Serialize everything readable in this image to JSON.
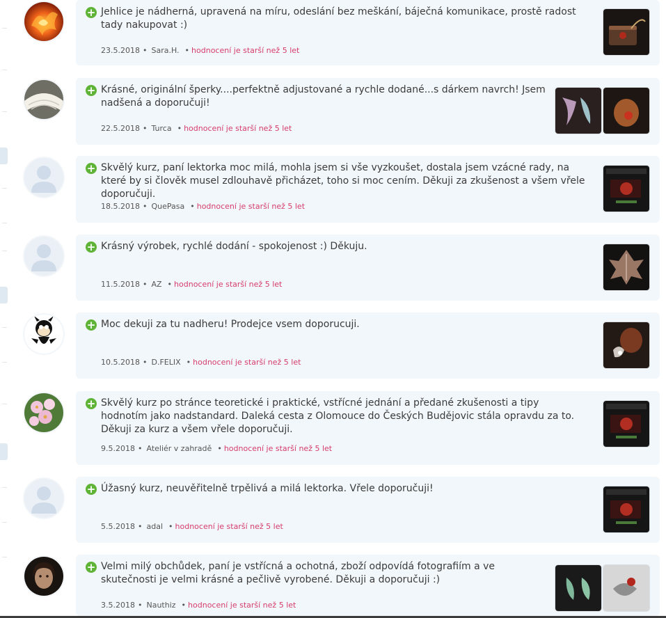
{
  "old_label": "hodnocení je starší než 5 let",
  "reviews": [
    {
      "text": "Jehlice je nádherná, upravená na míru, odeslání bez meškání, báječná komunikace, prostě radost tady nakupovat :)",
      "date": "23.5.2018",
      "author": "Sara.H.",
      "photos": 1,
      "avatar_type": "phoenix-image"
    },
    {
      "text": "Krásné, originální šperky....perfektně adjustované a rychle dodané...s dárkem navrch! Jsem nadšená a doporučuji!",
      "date": "22.5.2018",
      "author": "Turca",
      "photos": 2,
      "avatar_type": "lace-image"
    },
    {
      "text": "Skvělý kurz, paní lektorka moc milá, mohla jsem si vše vyzkoušet, dostala jsem vzácné rady, na které by si člověk musel zdlouhavě přicházet, toho si moc cením. Děkuji za zkušenost a všem vřele doporučuji.",
      "date": "18.5.2018",
      "author": "QuePasa",
      "photos": 1,
      "avatar_type": "default-user"
    },
    {
      "text": "Krásný výrobek, rychlé dodání - spokojenost :) Děkuju.",
      "date": "11.5.2018",
      "author": "AZ",
      "photos": 1,
      "avatar_type": "default-user"
    },
    {
      "text": "Moc dekuji za tu nadheru! Prodejce vsem doporucuji.",
      "date": "10.5.2018",
      "author": "D.FELIX",
      "photos": 1,
      "avatar_type": "felix-cat-image"
    },
    {
      "text": "Skvělý kurz po stránce teoretické i praktické, vstřícné jednání a předané zkušenosti a tipy hodnotím jako nadstandard. Daleká cesta z Olomouce do Českých Budějovic stála opravdu za to. Děkuji za kurz a všem vřele doporučuji.",
      "date": "9.5.2018",
      "author": "Ateliér v zahradě",
      "photos": 1,
      "avatar_type": "flowers-image"
    },
    {
      "text": "Úžasný kurz, neuvěřitelně trpělivá a milá lektorka. Vřele doporučuji!",
      "date": "5.5.2018",
      "author": "adal",
      "photos": 1,
      "avatar_type": "default-user"
    },
    {
      "text": "Velmi milý obchůdek, paní je vstřícná a ochotná, zboží odpovídá fotografiím a ve skutečnosti je velmi krásné a pečlivě vyrobené. Děkuji a doporučuji :)",
      "date": "3.5.2018",
      "author": "Nauthiz",
      "photos": 2,
      "avatar_type": "portrait-image"
    }
  ],
  "colors": {
    "bubble": "#f2f7fb",
    "plus": "#5fb336",
    "old_label": "#d63c6a",
    "text": "#3b3b3b"
  }
}
